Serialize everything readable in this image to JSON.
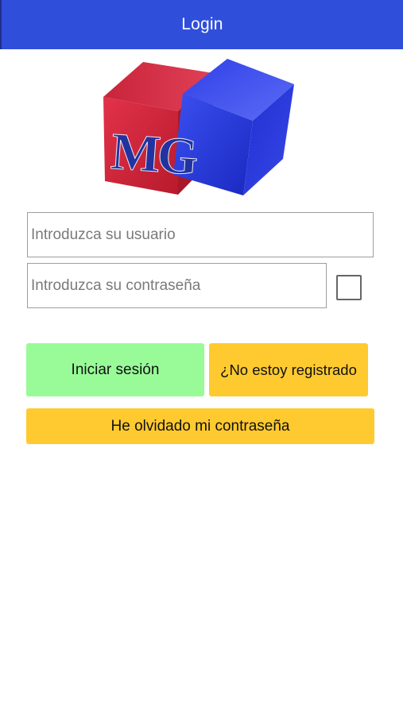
{
  "app_bar": {
    "title": "Login"
  },
  "logo": {
    "text": "MG",
    "cube_colors": {
      "left": "#d42a3c",
      "right": "#2436d6",
      "letters": "#2233a0"
    }
  },
  "form": {
    "username_placeholder": "Introduzca su usuario",
    "username_value": "",
    "password_placeholder": "Introduzca su contraseña",
    "password_value": "",
    "show_password_checked": false
  },
  "buttons": {
    "login_label": "Iniciar sesión",
    "register_label": "¿No estoy registrado",
    "forgot_label": "He olvidado mi contraseña"
  },
  "colors": {
    "app_bar": "#2f4fdb",
    "login_button": "#98fb98",
    "secondary_button": "#ffca30"
  }
}
